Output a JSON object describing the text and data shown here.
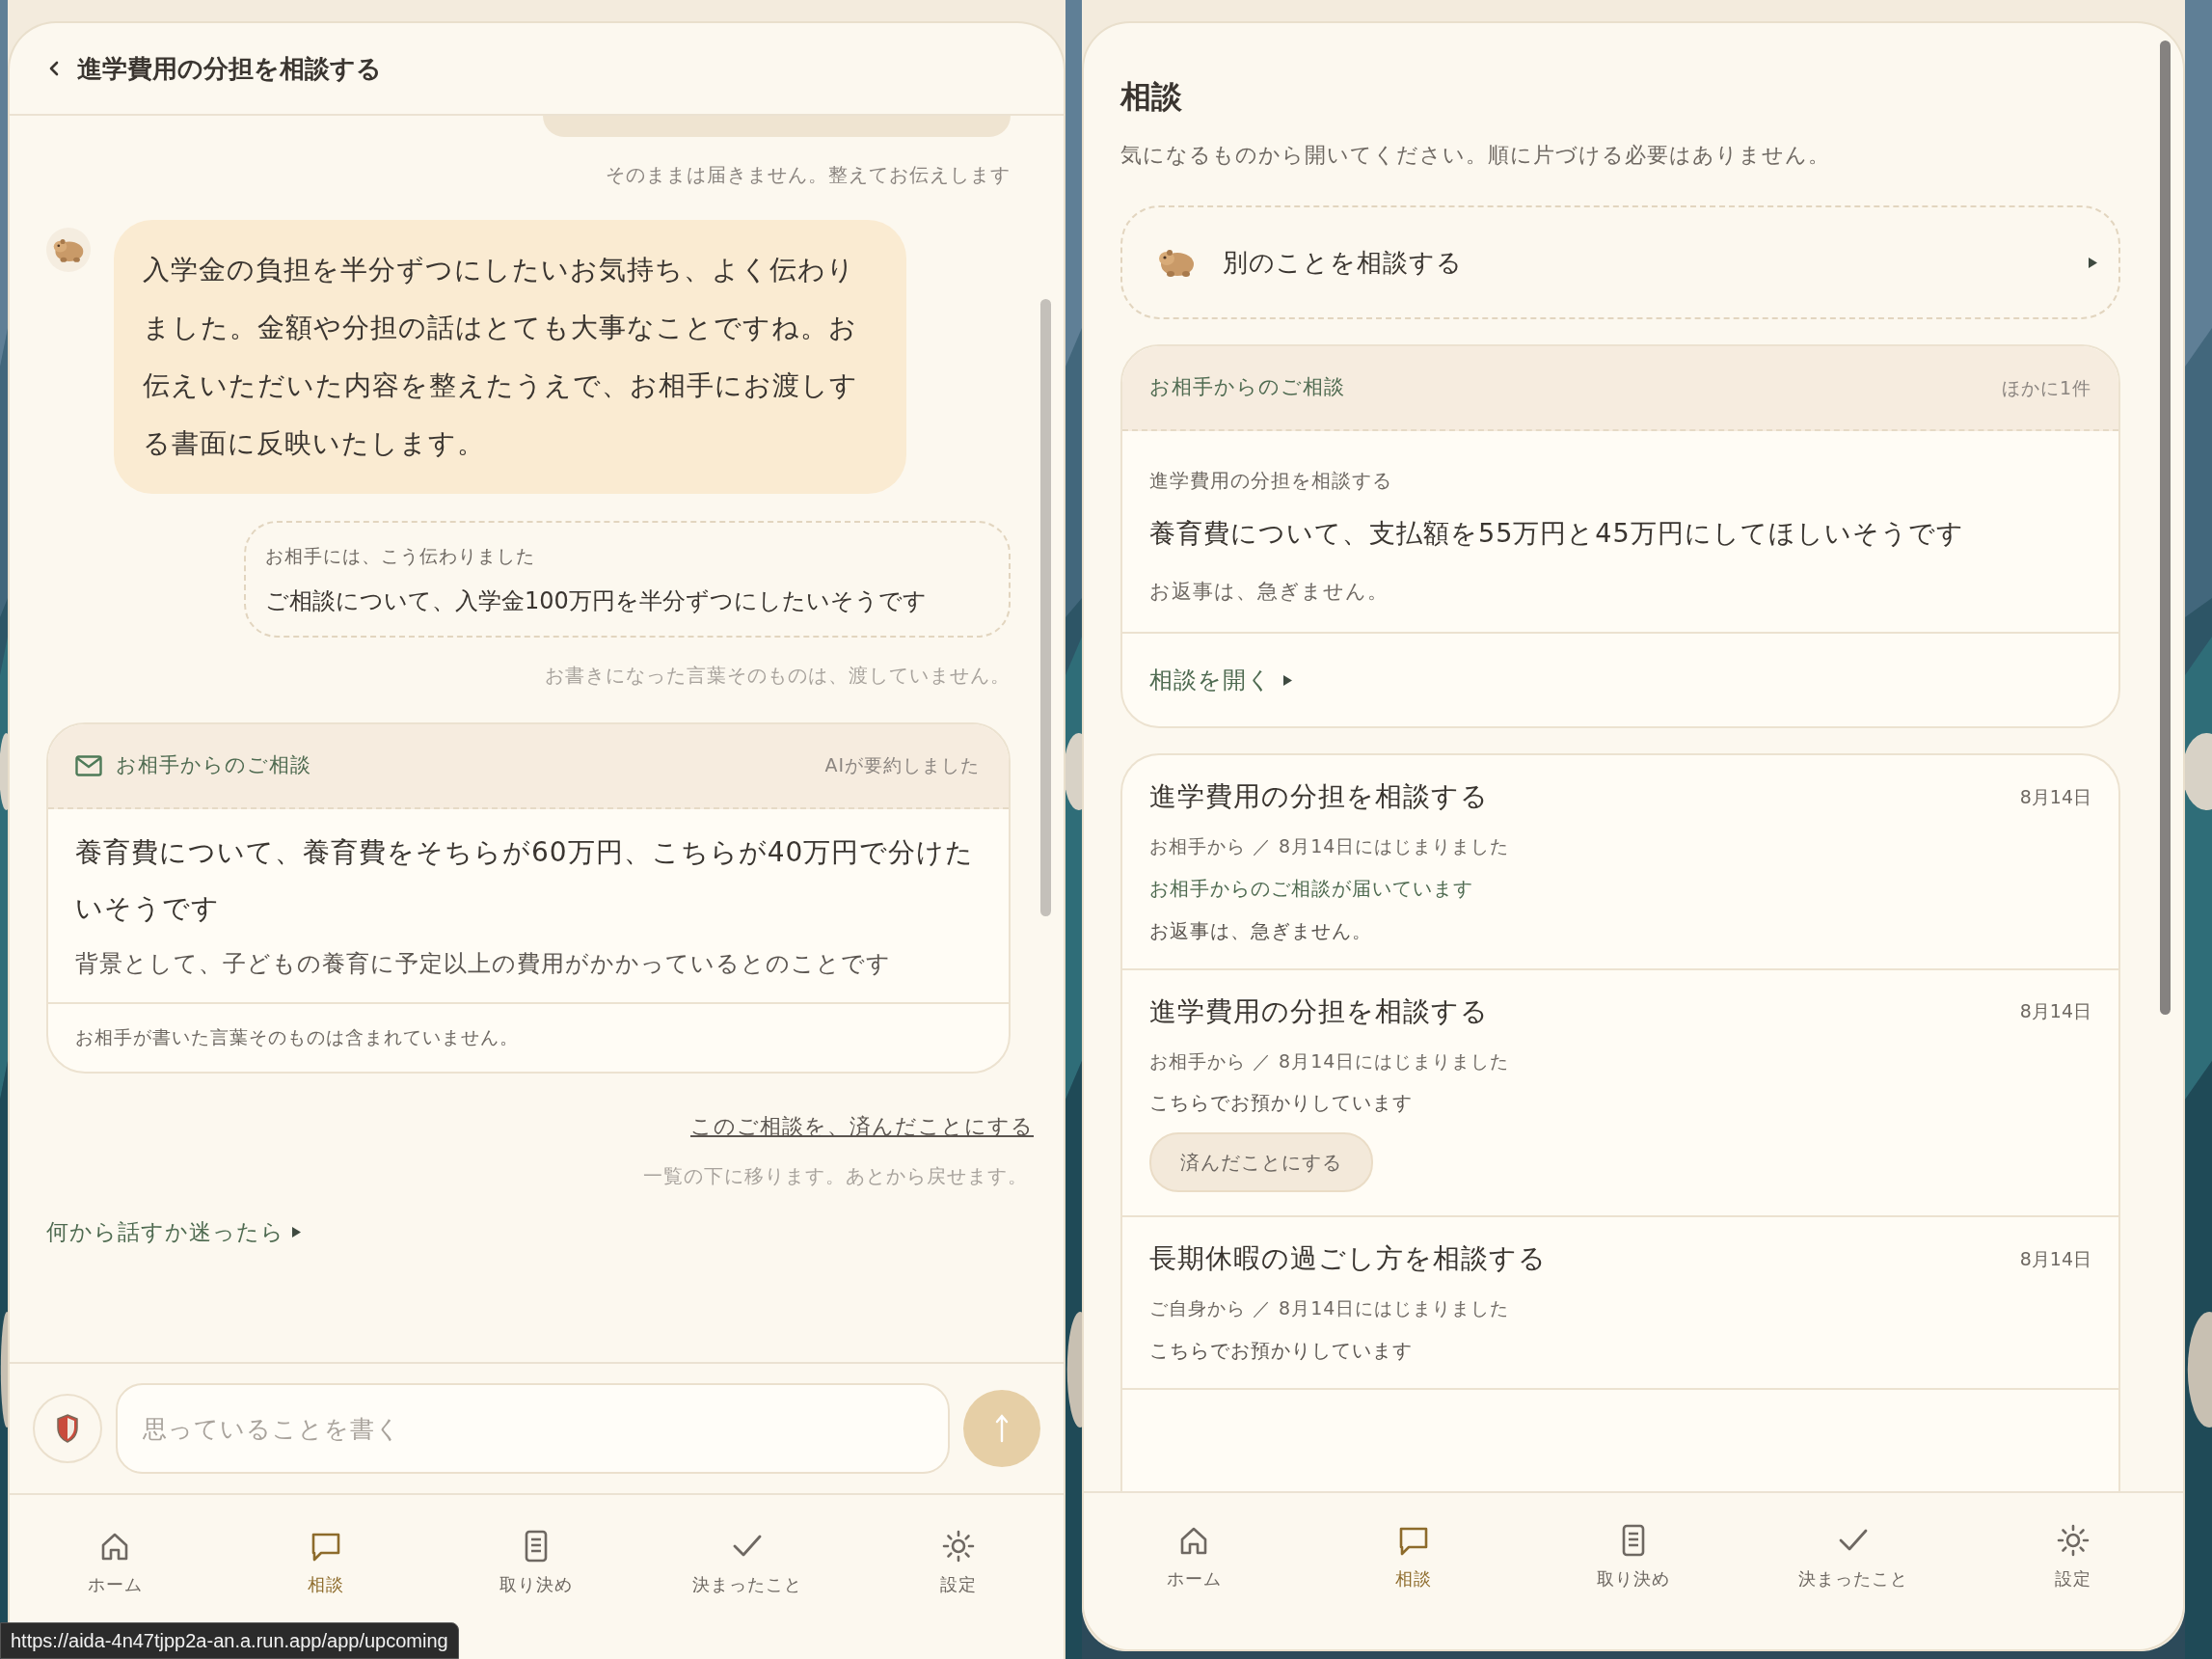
{
  "status_url": "https://aida-4n47tjpp2a-an.a.run.app/app/upcoming",
  "chat": {
    "title": "進学費用の分担を相談する",
    "thread": [
      {
        "kind": "cut_bubble"
      },
      {
        "kind": "note",
        "text": "そのままは届きません。整えてお伝えします"
      },
      {
        "kind": "reply",
        "text": "入学金の負担を半分ずつにしたいお気持ち、よく伝わりました。金額や分担の話はとても大事なことですね。お伝えいただいた内容を整えたうえで、お相手にお渡しする書面に反映いたします。"
      },
      {
        "kind": "relayed",
        "label": "お相手には、こう伝わりました",
        "text": "ご相談について、入学金100万円を半分ずつにしたいそうです"
      },
      {
        "kind": "faint_note",
        "text": "お書きになった言葉そのものは、渡していません。"
      },
      {
        "kind": "request",
        "heading": "お相手からのご相談",
        "tag": "AIが要約しました",
        "summary": "養育費について、養育費をそちらが60万円、こちらが40万円で分けたいそうです",
        "background": "背景として、子どもの養育に予定以上の費用がかかっているとのことです",
        "footer": "お相手が書いた言葉そのものは含まれていません。"
      }
    ],
    "resolve_link": "このご相談を、済んだことにする",
    "resolve_note": "一覧の下に移ります。あとから戻せます。",
    "hint": "何から話すか迷ったら",
    "composer": {
      "placeholder": "思っていることを書く"
    },
    "nav": [
      {
        "label": "ホーム",
        "selected": false
      },
      {
        "label": "相談",
        "selected": true
      },
      {
        "label": "取り決め",
        "selected": false
      },
      {
        "label": "決まったこと",
        "selected": false
      },
      {
        "label": "設定",
        "selected": false
      }
    ]
  },
  "list": {
    "title": "相談",
    "subtitle": "気になるものから開いてください。順に片づける必要はありません。",
    "new_topic": "別のことを相談する",
    "incoming": {
      "heading": "お相手からのご相談",
      "count": "ほかに1件",
      "topic": "進学費用の分担を相談する",
      "summary": "養育費について、支払額を55万円と45万円にしてほしいそうです",
      "urgency": "お返事は、急ぎません。",
      "open": "相談を開く"
    },
    "threads": [
      {
        "title": "進学費用の分担を相談する",
        "date": "8月14日",
        "meta": "お相手から ／ 8月14日にはじまりました",
        "lines": [
          {
            "kind": "alert",
            "text": "お相手からのご相談が届いています"
          },
          {
            "kind": "plain",
            "text": "お返事は、急ぎません。"
          }
        ]
      },
      {
        "title": "進学費用の分担を相談する",
        "date": "8月14日",
        "meta": "お相手から ／ 8月14日にはじまりました",
        "lines": [
          {
            "kind": "plain",
            "text": "こちらでお預かりしています"
          }
        ],
        "action": "済んだことにする"
      },
      {
        "title": "長期休暇の過ごし方を相談する",
        "date": "8月14日",
        "meta": "ご自身から ／ 8月14日にはじまりました",
        "lines": [
          {
            "kind": "plain",
            "text": "こちらでお預かりしています"
          }
        ]
      }
    ],
    "nav": [
      {
        "label": "ホーム",
        "selected": false
      },
      {
        "label": "相談",
        "selected": true
      },
      {
        "label": "取り決め",
        "selected": false
      },
      {
        "label": "決まったこと",
        "selected": false
      },
      {
        "label": "設定",
        "selected": false
      }
    ]
  }
}
